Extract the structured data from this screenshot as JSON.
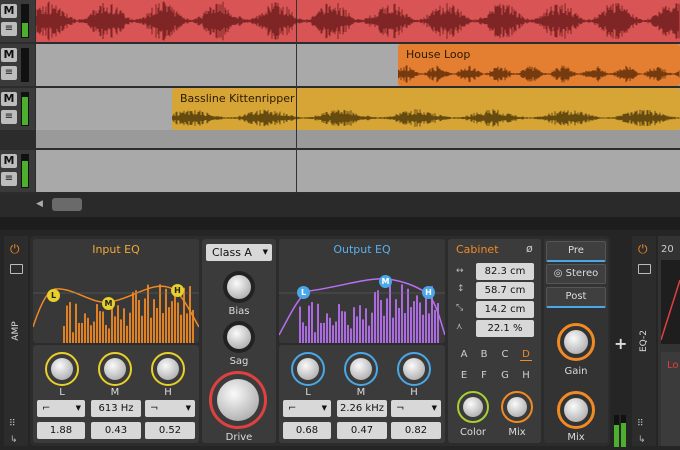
{
  "colors": {
    "accent_orange": "#f08a24",
    "accent_blue": "#4aa8e8",
    "accent_yellow": "#e8d02a",
    "accent_purple": "#b870f0",
    "track1_clip": "#e05a5a",
    "track2_clip": "#e48030",
    "track3_clip": "#d6a535"
  },
  "tracks": [
    {
      "mute": "M",
      "menu": "≡"
    },
    {
      "mute": "M",
      "menu": "≡"
    },
    {
      "mute": "M",
      "menu": "≡"
    },
    {
      "mute": "M",
      "menu": "≡"
    }
  ],
  "clips": {
    "house": "House Loop",
    "bassline": "Bassline Kittenripper"
  },
  "arranger": {
    "scroll_left": "◀"
  },
  "device": {
    "side_label": "AMP",
    "input_eq": {
      "title": "Input EQ",
      "band_labels": [
        "L",
        "M",
        "H"
      ],
      "knobs": [
        "L",
        "M",
        "H"
      ],
      "freq": "613 Hz",
      "values": [
        "1.88",
        "0.43",
        "0.52"
      ]
    },
    "class": {
      "value": "Class A",
      "bias": "Bias",
      "sag": "Sag",
      "drive": "Drive"
    },
    "output_eq": {
      "title": "Output EQ",
      "band_labels": [
        "L",
        "M",
        "H"
      ],
      "knobs": [
        "L",
        "M",
        "H"
      ],
      "freq": "2.26 kHz",
      "values": [
        "0.68",
        "0.47",
        "0.82"
      ]
    },
    "cabinet": {
      "title": "Cabinet",
      "dims": [
        "82.3 cm",
        "58.7 cm",
        "14.2 cm",
        "22.1 %"
      ],
      "letters": [
        "A",
        "B",
        "C",
        "D",
        "E",
        "F",
        "G",
        "H"
      ],
      "selected": "D",
      "color": "Color",
      "mix": "Mix"
    },
    "pre": "Pre",
    "stereo": "Stereo",
    "post": "Post",
    "gain": "Gain",
    "mix": "Mix"
  },
  "device2": {
    "side_label": "EQ-2",
    "partial_value": "20",
    "partial_label": "Lo"
  }
}
